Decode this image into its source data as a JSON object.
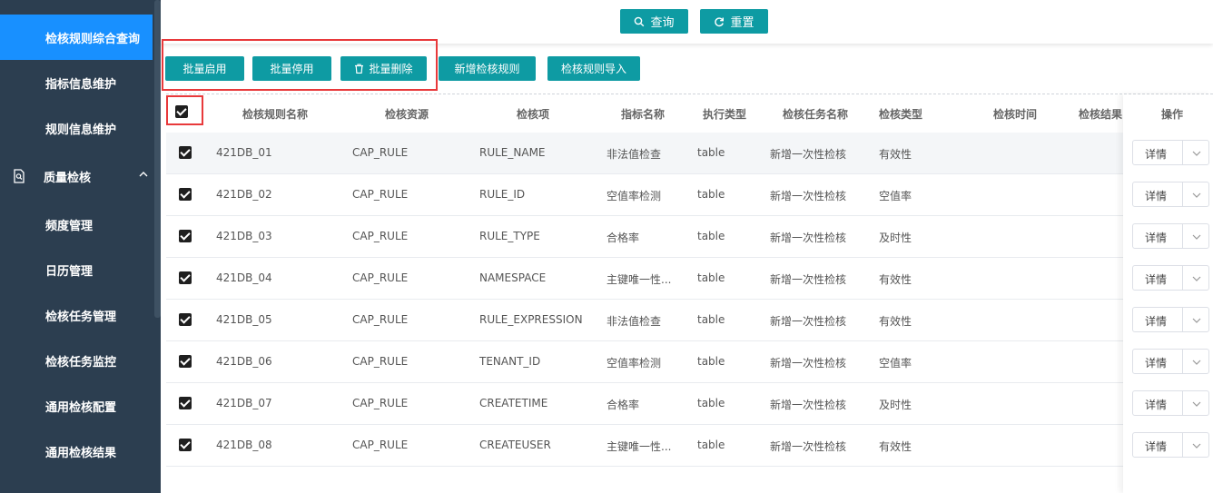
{
  "sidebar": {
    "items": [
      {
        "label": "检核规则综合查询"
      },
      {
        "label": "指标信息维护"
      },
      {
        "label": "规则信息维护"
      },
      {
        "label": "频度管理"
      },
      {
        "label": "日历管理"
      },
      {
        "label": "检核任务管理"
      },
      {
        "label": "检核任务监控"
      },
      {
        "label": "通用检核配置"
      },
      {
        "label": "通用检核结果"
      }
    ],
    "group": {
      "label": "质量检核"
    }
  },
  "search": {
    "query_label": "查询",
    "reset_label": "重置"
  },
  "toolbar": {
    "batch_enable": "批量启用",
    "batch_disable": "批量停用",
    "batch_delete": "批量删除",
    "add_rule": "新增检核规则",
    "import_rule": "检核规则导入"
  },
  "table": {
    "headers": {
      "name": "检核规则名称",
      "resource": "检核资源",
      "item": "检核项",
      "metric": "指标名称",
      "exec_type": "执行类型",
      "task": "检核任务名称",
      "check_type": "检核类型",
      "check_time": "检核时间",
      "result": "检核结果",
      "ops": "操作"
    },
    "rows": [
      {
        "name": "421DB_01",
        "resource": "CAP_RULE",
        "item": "RULE_NAME",
        "metric": "非法值检查",
        "exec_type": "table",
        "task": "新增一次性检核",
        "check_type": "有效性",
        "action": "详情"
      },
      {
        "name": "421DB_02",
        "resource": "CAP_RULE",
        "item": "RULE_ID",
        "metric": "空值率检测",
        "exec_type": "table",
        "task": "新增一次性检核",
        "check_type": "空值率",
        "action": "详情"
      },
      {
        "name": "421DB_03",
        "resource": "CAP_RULE",
        "item": "RULE_TYPE",
        "metric": "合格率",
        "exec_type": "table",
        "task": "新增一次性检核",
        "check_type": "及时性",
        "action": "详情"
      },
      {
        "name": "421DB_04",
        "resource": "CAP_RULE",
        "item": "NAMESPACE",
        "metric": "主键唯一性...",
        "exec_type": "table",
        "task": "新增一次性检核",
        "check_type": "有效性",
        "action": "详情"
      },
      {
        "name": "421DB_05",
        "resource": "CAP_RULE",
        "item": "RULE_EXPRESSION",
        "metric": "非法值检查",
        "exec_type": "table",
        "task": "新增一次性检核",
        "check_type": "有效性",
        "action": "详情"
      },
      {
        "name": "421DB_06",
        "resource": "CAP_RULE",
        "item": "TENANT_ID",
        "metric": "空值率检测",
        "exec_type": "table",
        "task": "新增一次性检核",
        "check_type": "空值率",
        "action": "详情"
      },
      {
        "name": "421DB_07",
        "resource": "CAP_RULE",
        "item": "CREATETIME",
        "metric": "合格率",
        "exec_type": "table",
        "task": "新增一次性检核",
        "check_type": "及时性",
        "action": "详情"
      },
      {
        "name": "421DB_08",
        "resource": "CAP_RULE",
        "item": "CREATEUSER",
        "metric": "主键唯一性...",
        "exec_type": "table",
        "task": "新增一次性检核",
        "check_type": "有效性",
        "action": "详情"
      }
    ]
  },
  "colors": {
    "accent": "#0e9ba3",
    "sidebar_bg": "#2c3e50",
    "active": "#1890ff",
    "highlight_box": "#e8393b"
  }
}
